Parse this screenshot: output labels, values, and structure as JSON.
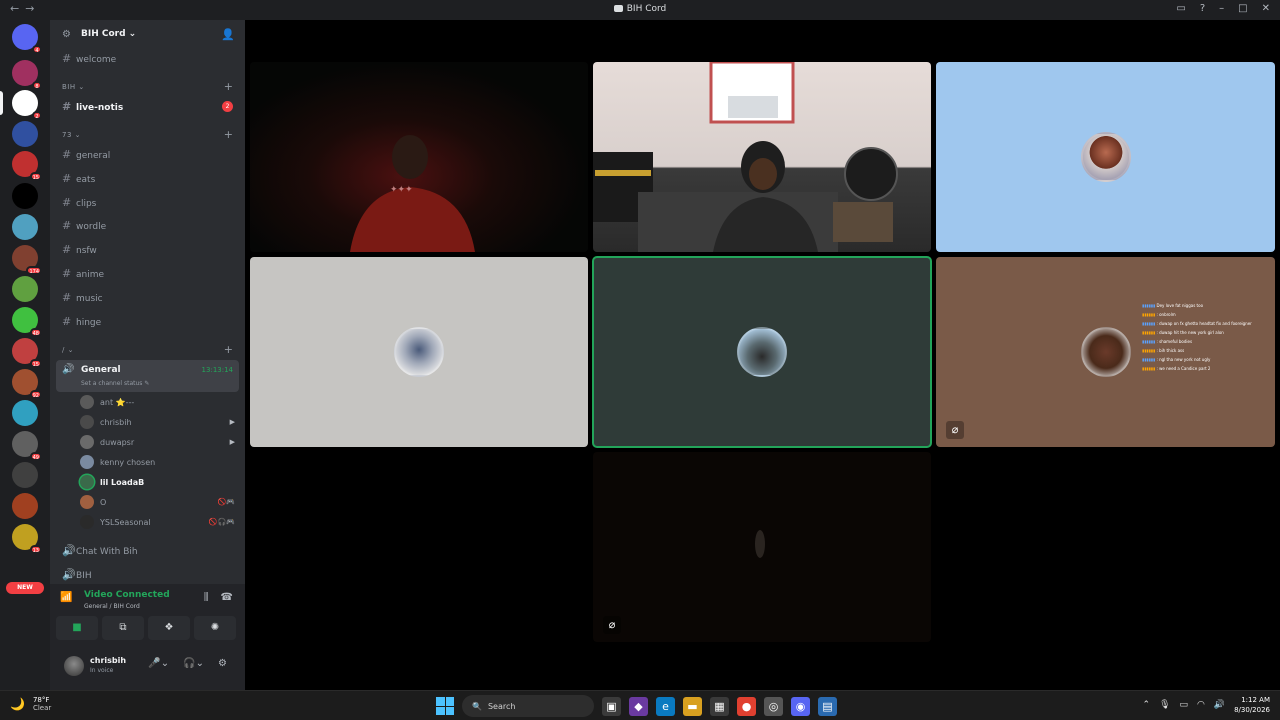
{
  "window": {
    "title": "BIH Cord"
  },
  "server_rail": {
    "servers": [
      {
        "name": "discord-home-icon",
        "badge": "4",
        "color": "#5865f2"
      },
      {
        "name": "server-2",
        "badge": "8",
        "color": "#a03060"
      },
      {
        "name": "server-bih",
        "badge": "2",
        "color": "#ffffff",
        "active": true
      },
      {
        "name": "server-4",
        "badge": "",
        "color": "#3050a0"
      },
      {
        "name": "server-5",
        "badge": "15",
        "color": "#c03030"
      },
      {
        "name": "server-6",
        "badge": "",
        "color": "#000000"
      },
      {
        "name": "server-7",
        "badge": "",
        "color": "#50a0c0"
      },
      {
        "name": "server-8",
        "badge": "174",
        "color": "#804030"
      },
      {
        "name": "server-9",
        "badge": "",
        "color": "#60a040"
      },
      {
        "name": "server-10",
        "badge": "48",
        "color": "#40c040"
      },
      {
        "name": "server-11",
        "badge": "15",
        "color": "#c04040"
      },
      {
        "name": "server-12",
        "badge": "92",
        "color": "#a05030"
      },
      {
        "name": "server-13",
        "badge": "",
        "color": "#30a0c0"
      },
      {
        "name": "server-14",
        "badge": "49",
        "color": "#606060"
      },
      {
        "name": "server-15",
        "badge": "",
        "color": "#404040"
      },
      {
        "name": "server-16",
        "badge": "",
        "color": "#a04020"
      },
      {
        "name": "server-17",
        "badge": "13",
        "color": "#c0a020"
      }
    ],
    "new_label": "NEW"
  },
  "sidebar": {
    "server_name": "BIH Cord",
    "welcome": "welcome",
    "categories": [
      {
        "label": "BIH",
        "channels": [
          {
            "name": "live-notis",
            "active": true,
            "unread": "2"
          }
        ]
      },
      {
        "label": "73",
        "channels": [
          {
            "name": "general"
          },
          {
            "name": "eats"
          },
          {
            "name": "clips"
          },
          {
            "name": "wordle"
          },
          {
            "name": "nsfw"
          },
          {
            "name": "anime"
          },
          {
            "name": "music"
          },
          {
            "name": "hinge"
          }
        ]
      },
      {
        "label": "/"
      }
    ],
    "voice_channel": {
      "name": "General",
      "timer": "13:13:14",
      "status": "Set a channel status",
      "members": [
        {
          "name": "ant",
          "extra": "⭐---",
          "speaking": false,
          "icons": ""
        },
        {
          "name": "chrisbih",
          "speaking": false,
          "icons": "▶"
        },
        {
          "name": "duwapsr",
          "speaking": false,
          "icons": "▶"
        },
        {
          "name": "kenny chosen",
          "speaking": false,
          "icons": ""
        },
        {
          "name": "lil LoadaB",
          "speaking": true,
          "icons": ""
        },
        {
          "name": "O",
          "speaking": false,
          "icons": "🚫🎮"
        },
        {
          "name": "YSLSeasonal",
          "speaking": false,
          "icons": "🚫🎧🎮"
        }
      ]
    },
    "other_voice": [
      "Chat With Bih",
      "BIH"
    ]
  },
  "voice_panel": {
    "status": "Video Connected",
    "sub": "General / BIH Cord"
  },
  "user_panel": {
    "name": "chrisbih",
    "status": "In voice"
  },
  "stage": {
    "tiles": [
      {
        "name": "tile-dark-video",
        "kind": "video-dark"
      },
      {
        "name": "tile-room-video",
        "kind": "video-room"
      },
      {
        "name": "tile-blue-avatar",
        "kind": "avatar",
        "bg": "#9fc7ee"
      },
      {
        "name": "tile-grey-avatar",
        "kind": "avatar",
        "bg": "#c6c5c2"
      },
      {
        "name": "tile-speaking-avatar",
        "kind": "avatar",
        "bg": "#2f3b38",
        "speaking": true
      },
      {
        "name": "tile-brown-avatar",
        "kind": "avatar",
        "bg": "#7a5a48",
        "muted": true
      },
      {
        "name": "tile-bottom-dark",
        "kind": "video-empty",
        "muted": true
      }
    ],
    "chat_overlay": [
      {
        "user": "",
        "text": "Dey love fat niggas too"
      },
      {
        "user": "",
        "text": ": onbrolm"
      },
      {
        "user": "",
        "text": ": duwap on fx ghetto headtat fix and fooreigner"
      },
      {
        "user": "",
        "text": ": duwap hit the new york girl alon"
      },
      {
        "user": "",
        "text": ": shameful bodies"
      },
      {
        "user": "",
        "text": ": bih thick ass"
      },
      {
        "user": "",
        "text": ": ngl tha new york not ugly"
      },
      {
        "user": "",
        "text": ": we need a Candice part 2"
      }
    ]
  },
  "taskbar": {
    "temp": "78°F",
    "condition": "Clear",
    "search": "Search",
    "time": "1:12 AM",
    "date": "8/30/2026"
  }
}
